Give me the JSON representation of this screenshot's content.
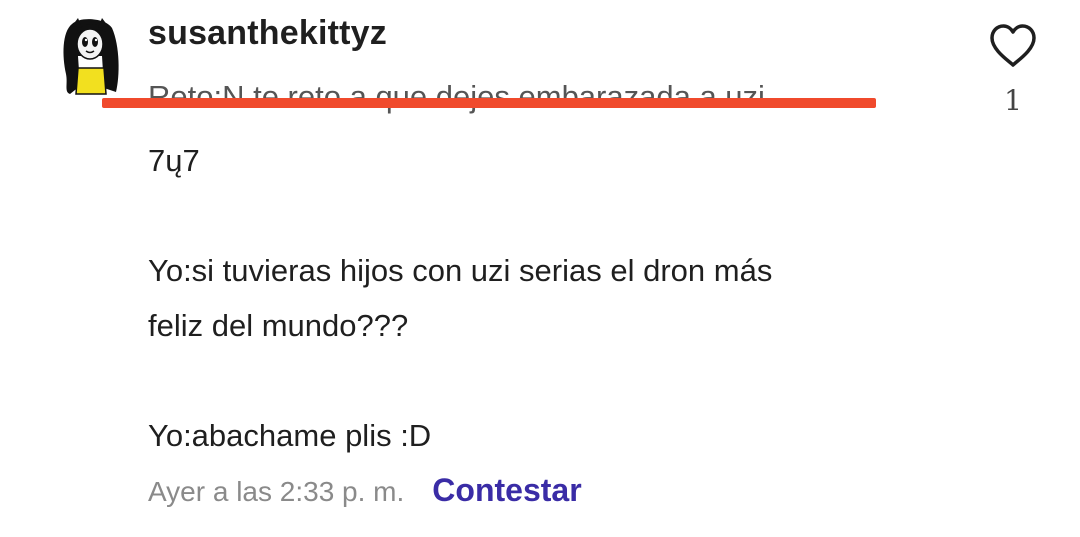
{
  "comment": {
    "avatar_icon": "character-avatar-icon",
    "username": "susanthekittyz",
    "lines": [
      "Reto:N te reto a que dejes embarazada a uzi",
      "7ų7",
      "",
      "Yo:si tuvieras hijos con uzi serias el dron más",
      "feliz del mundo???",
      "",
      "Yo:abachame plis :D"
    ],
    "timestamp": "Ayer a las 2:33 p. m.",
    "reply_label": "Contestar",
    "like_icon": "heart-outline-icon",
    "like_count": "1",
    "redaction_color": "#f04a2c",
    "reply_color": "#3a2ca6"
  }
}
